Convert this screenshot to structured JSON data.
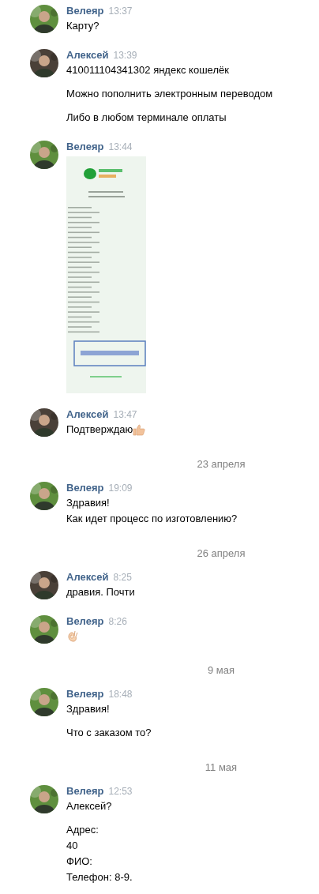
{
  "feed": [
    {
      "kind": "message",
      "author": "Велеяр",
      "color": "#5f8f3e",
      "time": "13:37",
      "paragraphs": [
        [
          "Карту?"
        ]
      ]
    },
    {
      "kind": "message",
      "author": "Алексей",
      "color": "#4a4038",
      "time": "13:39",
      "paragraphs": [
        [
          "410011104341302 яндекс кошелёк"
        ],
        [
          "Можно пополнить электронным переводом"
        ],
        [
          "Либо в любом терминале оплаты"
        ]
      ]
    },
    {
      "kind": "message",
      "author": "Велеяр",
      "color": "#5f8f3e",
      "time": "13:44"
    },
    {
      "kind": "message",
      "author": "Алексей",
      "color": "#4a4038",
      "time": "13:47",
      "paragraphs": [
        [
          "Подтверждаю"
        ]
      ],
      "thumbs_up": true
    },
    {
      "kind": "date",
      "text": "23 апреля"
    },
    {
      "kind": "message",
      "author": "Велеяр",
      "color": "#5f8f3e",
      "time": "19:09",
      "paragraphs": [
        [
          "Здравия!",
          "Как идет процесс по изготовлению?"
        ]
      ]
    },
    {
      "kind": "date",
      "text": "26 апреля"
    },
    {
      "kind": "message",
      "author": "Алексей",
      "color": "#4a4038",
      "time": "8:25",
      "paragraphs": [
        [
          "дравия. Почти"
        ]
      ]
    },
    {
      "kind": "message",
      "author": "Велеяр",
      "color": "#5f8f3e",
      "time": "8:26",
      "ok_hand": true
    },
    {
      "kind": "date",
      "text": "9 мая"
    },
    {
      "kind": "message",
      "author": "Велеяр",
      "color": "#5f8f3e",
      "time": "18:48",
      "paragraphs": [
        [
          "Здравия!"
        ],
        [
          "Что с заказом то?"
        ]
      ]
    },
    {
      "kind": "date",
      "text": "11 мая"
    },
    {
      "kind": "message",
      "author": "Велеяр",
      "color": "#5f8f3e",
      "time": "12:53",
      "paragraphs": [
        [
          "Алексей?"
        ],
        [
          "Адрес:",
          "40",
          "ФИО:",
          "Телефон: 8-9."
        ]
      ]
    }
  ]
}
